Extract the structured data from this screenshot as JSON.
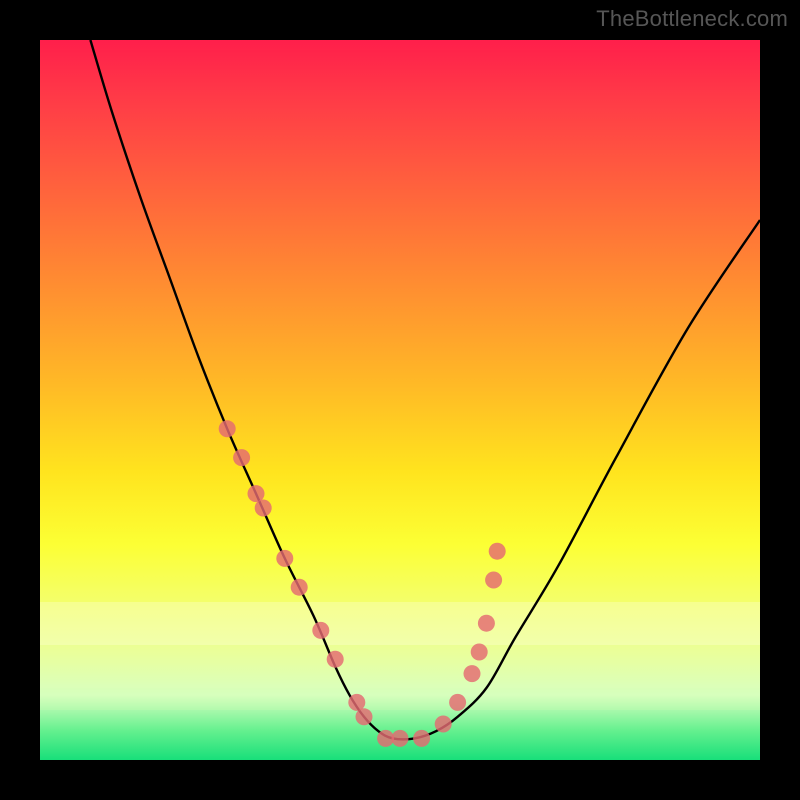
{
  "watermark": "TheBottleneck.com",
  "chart_data": {
    "type": "line",
    "title": "",
    "xlabel": "",
    "ylabel": "",
    "xlim": [
      0,
      100
    ],
    "ylim": [
      0,
      100
    ],
    "series": [
      {
        "name": "curve",
        "x": [
          7,
          10,
          14,
          18,
          22,
          26,
          30,
          34,
          38,
          41,
          43,
          45,
          47,
          49,
          52,
          55,
          58,
          62,
          66,
          72,
          80,
          90,
          100
        ],
        "values": [
          100,
          90,
          78,
          67,
          56,
          46,
          37,
          28,
          20,
          13,
          9,
          6,
          4,
          3,
          3,
          4,
          6,
          10,
          17,
          27,
          42,
          60,
          75
        ]
      }
    ],
    "markers": {
      "name": "highlighted-points",
      "color": "#e46a72",
      "x": [
        26,
        28,
        30,
        31,
        34,
        36,
        39,
        41,
        44,
        45,
        48,
        50,
        53,
        56,
        58,
        60,
        61,
        62,
        63,
        63.5
      ],
      "values": [
        46,
        42,
        37,
        35,
        28,
        24,
        18,
        14,
        8,
        6,
        3,
        3,
        3,
        5,
        8,
        12,
        15,
        19,
        25,
        29
      ]
    },
    "gradient_stops": [
      {
        "pos": 0,
        "color": "#ff1f4b"
      },
      {
        "pos": 60,
        "color": "#ffe41e"
      },
      {
        "pos": 96,
        "color": "#63f08e"
      },
      {
        "pos": 100,
        "color": "#18df7a"
      }
    ]
  }
}
